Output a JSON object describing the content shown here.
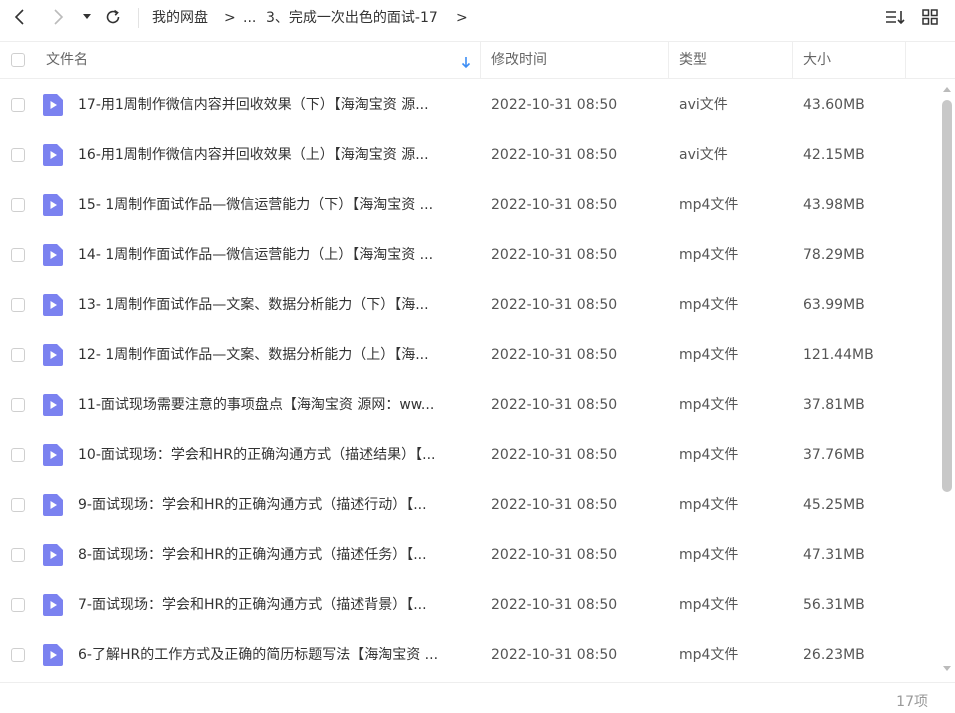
{
  "toolbar": {
    "breadcrumb": [
      "我的网盘",
      ">",
      "...",
      "3、完成一次出色的面试-17",
      ">"
    ]
  },
  "columns": {
    "name": "文件名",
    "time": "修改时间",
    "type": "类型",
    "size": "大小"
  },
  "files": [
    {
      "name": "17-用1周制作微信内容并回收效果（下）【海淘宝资 源...",
      "time": "2022-10-31 08:50",
      "type": "avi文件",
      "size": "43.60MB"
    },
    {
      "name": "16-用1周制作微信内容并回收效果（上）【海淘宝资 源...",
      "time": "2022-10-31 08:50",
      "type": "avi文件",
      "size": "42.15MB"
    },
    {
      "name": "15- 1周制作面试作品—微信运营能力（下）【海淘宝资 ...",
      "time": "2022-10-31 08:50",
      "type": "mp4文件",
      "size": "43.98MB"
    },
    {
      "name": "14- 1周制作面试作品—微信运营能力（上）【海淘宝资 ...",
      "time": "2022-10-31 08:50",
      "type": "mp4文件",
      "size": "78.29MB"
    },
    {
      "name": "13- 1周制作面试作品—文案、数据分析能力（下）【海...",
      "time": "2022-10-31 08:50",
      "type": "mp4文件",
      "size": "63.99MB"
    },
    {
      "name": "12- 1周制作面试作品—文案、数据分析能力（上）【海...",
      "time": "2022-10-31 08:50",
      "type": "mp4文件",
      "size": "121.44MB"
    },
    {
      "name": "11-面试现场需要注意的事项盘点【海淘宝资 源网：ww...",
      "time": "2022-10-31 08:50",
      "type": "mp4文件",
      "size": "37.81MB"
    },
    {
      "name": "10-面试现场：学会和HR的正确沟通方式（描述结果）【...",
      "time": "2022-10-31 08:50",
      "type": "mp4文件",
      "size": "37.76MB"
    },
    {
      "name": "9-面试现场：学会和HR的正确沟通方式（描述行动）【...",
      "time": "2022-10-31 08:50",
      "type": "mp4文件",
      "size": "45.25MB"
    },
    {
      "name": "8-面试现场：学会和HR的正确沟通方式（描述任务）【...",
      "time": "2022-10-31 08:50",
      "type": "mp4文件",
      "size": "47.31MB"
    },
    {
      "name": "7-面试现场：学会和HR的正确沟通方式（描述背景）【...",
      "time": "2022-10-31 08:50",
      "type": "mp4文件",
      "size": "56.31MB"
    },
    {
      "name": "6-了解HR的工作方式及正确的简历标题写法【海淘宝资 ...",
      "time": "2022-10-31 08:50",
      "type": "mp4文件",
      "size": "26.23MB"
    }
  ],
  "footer": {
    "count": "17项"
  },
  "colors": {
    "file_icon": "#7b82f0",
    "sort_arrow": "#3d8ef5"
  },
  "icons": [
    "back-icon",
    "forward-icon",
    "dropdown-icon",
    "refresh-icon",
    "sort-list-icon",
    "grid-view-icon",
    "video-file-icon"
  ]
}
